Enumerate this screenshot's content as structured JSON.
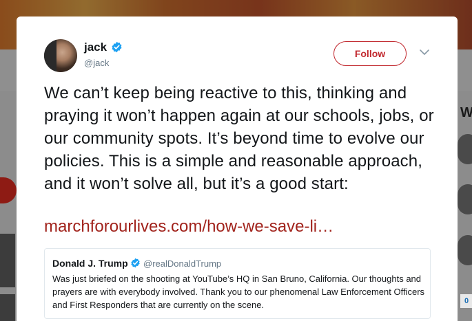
{
  "tweet": {
    "author_name": "jack",
    "author_handle": "@jack",
    "follow_label": "Follow",
    "text": "We can’t keep being reactive to this, thinking and praying it won’t happen again at our schools, jobs, or our community spots. It’s beyond time to evolve our policies. This is a simple and reasonable approach, and it won’t solve all, but it’s a good start:",
    "link_text": "marchforourlives.com/how-we-save-li…"
  },
  "quoted_tweet": {
    "author_name": "Donald J. Trump",
    "author_handle": "@realDonaldTrump",
    "text": "Was just briefed on the shooting at YouTube’s HQ in San Bruno, California. Our thoughts and prayers are with everybody involved. Thank you to our phenomenal Law Enforcement Officers and First Responders that are currently on the scene."
  },
  "background": {
    "right_panel_heading_fragment": "W",
    "right_badge_fragment": "0"
  },
  "colors": {
    "accent": "#c1272d",
    "link": "#a1231c",
    "verified": "#1da1f2",
    "secondary_text": "#657786"
  },
  "icons": {
    "verified": "verified-badge-icon",
    "menu": "chevron-down-icon"
  }
}
